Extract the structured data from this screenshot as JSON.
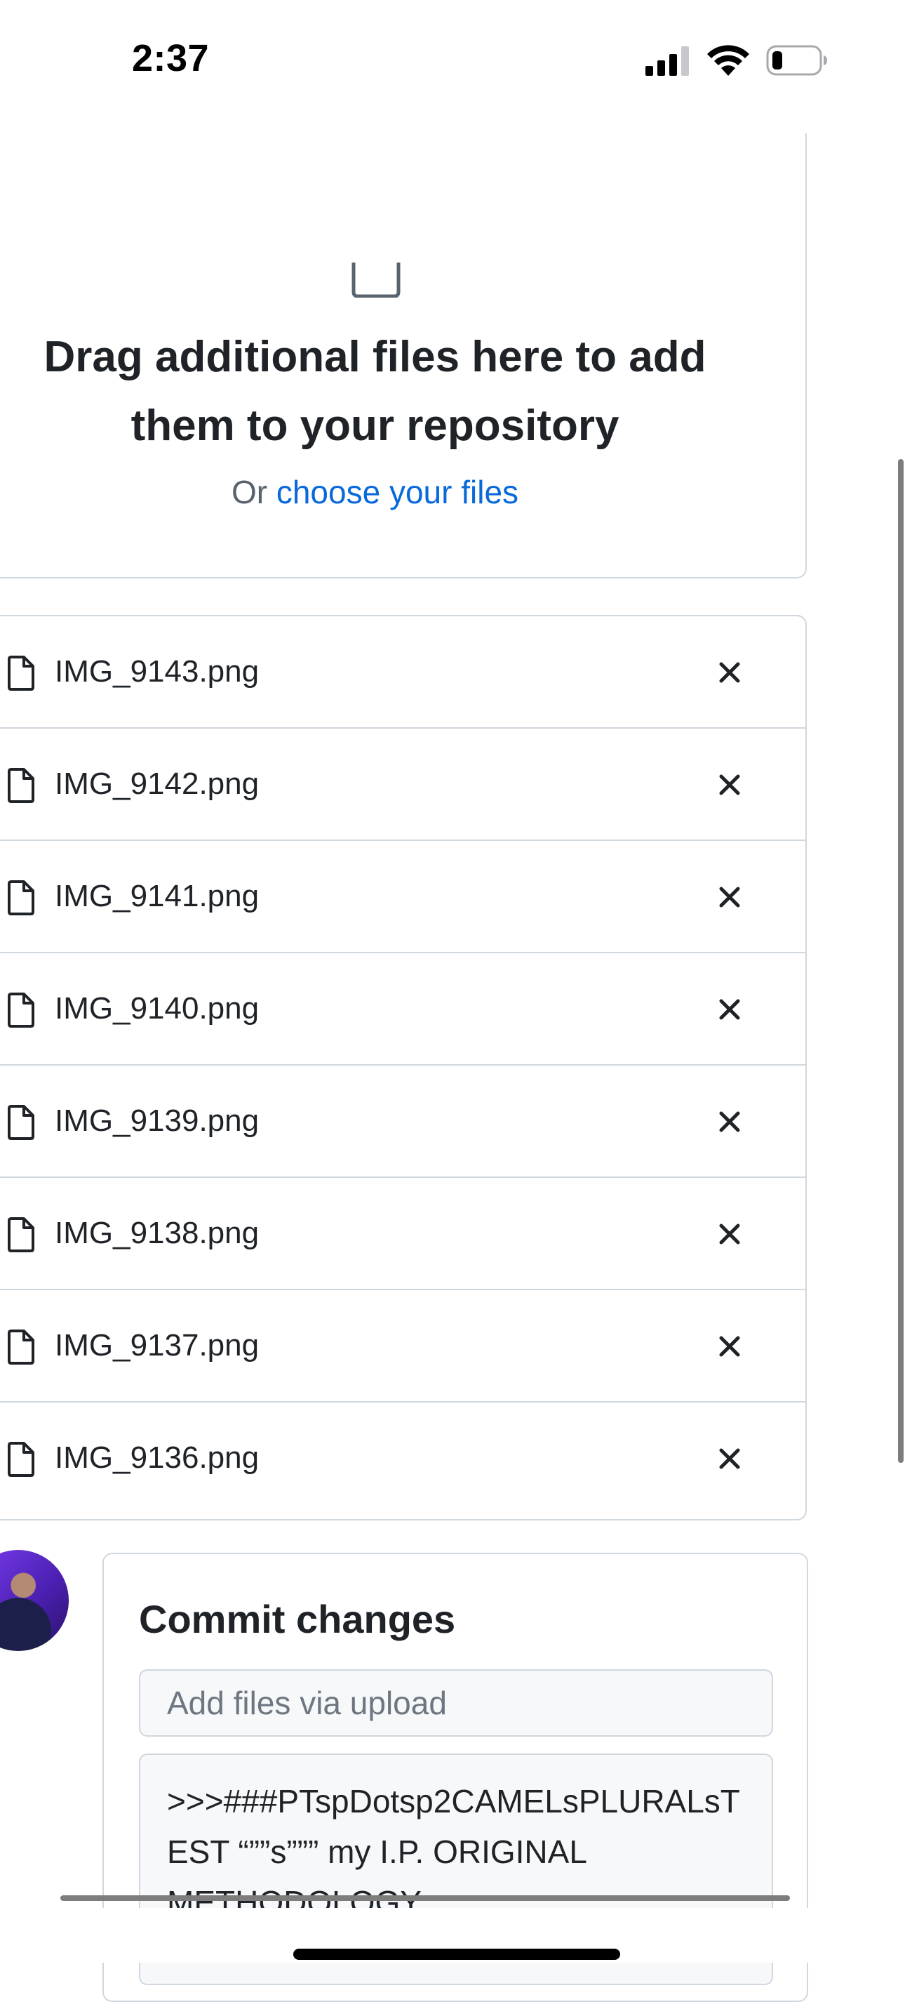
{
  "status_bar": {
    "time": "2:37",
    "signal_icon": "cellular-signal-icon",
    "wifi_icon": "wifi-icon",
    "battery_icon": "battery-low-icon"
  },
  "drop_zone": {
    "icon": "file-drop-icon",
    "title": "Drag additional files here to add them to your repository",
    "subtitle_prefix": "Or",
    "choose_link": "choose your files"
  },
  "files": [
    {
      "name": "IMG_9143.png"
    },
    {
      "name": "IMG_9142.png"
    },
    {
      "name": "IMG_9141.png"
    },
    {
      "name": "IMG_9140.png"
    },
    {
      "name": "IMG_9139.png"
    },
    {
      "name": "IMG_9138.png"
    },
    {
      "name": "IMG_9137.png"
    },
    {
      "name": "IMG_9136.png"
    }
  ],
  "commit": {
    "title": "Commit changes",
    "summary_placeholder": "Add files via upload",
    "description_value": ">>>###PTspDotsp2CAMELsPLURALsTEST “””s””” my I.P. ORIGINAL METHODOLOGY"
  },
  "colors": {
    "accent_link": "#0969da",
    "border": "#d0d7de",
    "field_bg": "#f6f8fa"
  }
}
